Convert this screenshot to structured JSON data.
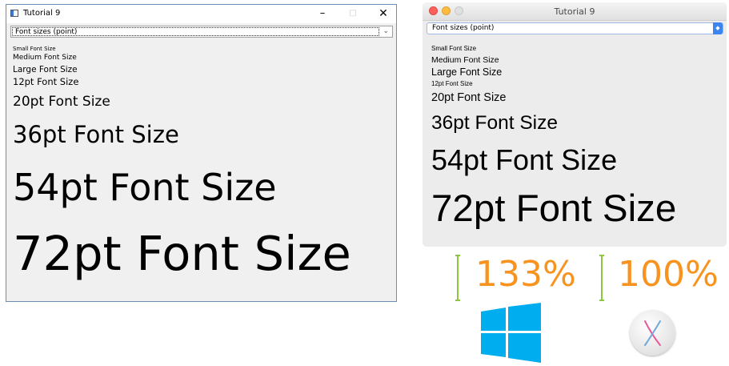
{
  "windows_window": {
    "title": "Tutorial 9",
    "controls": {
      "minimize": "–",
      "maximize": "□",
      "close": "✕"
    },
    "select": {
      "value": "Font sizes (point)",
      "arrow": "⌄"
    },
    "lines": [
      "Small Font Size",
      "Medium Font Size",
      "Large Font Size",
      "12pt Font Size",
      "20pt Font Size",
      "36pt Font Size",
      "54pt Font Size",
      "72pt Font Size"
    ]
  },
  "mac_window": {
    "title": "Tutorial 9",
    "select": {
      "value": "Font sizes (point)",
      "arrow": "◆"
    },
    "lines": [
      "Small Font Size",
      "Medium Font Size",
      "Large Font Size",
      "12pt Font Size",
      "20pt Font Size",
      "36pt Font Size",
      "54pt Font Size",
      "72pt Font Size"
    ]
  },
  "scales": {
    "windows": "133%",
    "mac": "100%"
  },
  "colors": {
    "accent_orange": "#f7931e",
    "bracket_green": "#8dc63f",
    "windows_blue": "#00adef",
    "mac_select_blue": "#3c84f0"
  },
  "icons": {
    "windows_logo": "windows-logo-icon",
    "mac_logo": "macos-x-logo-icon"
  }
}
